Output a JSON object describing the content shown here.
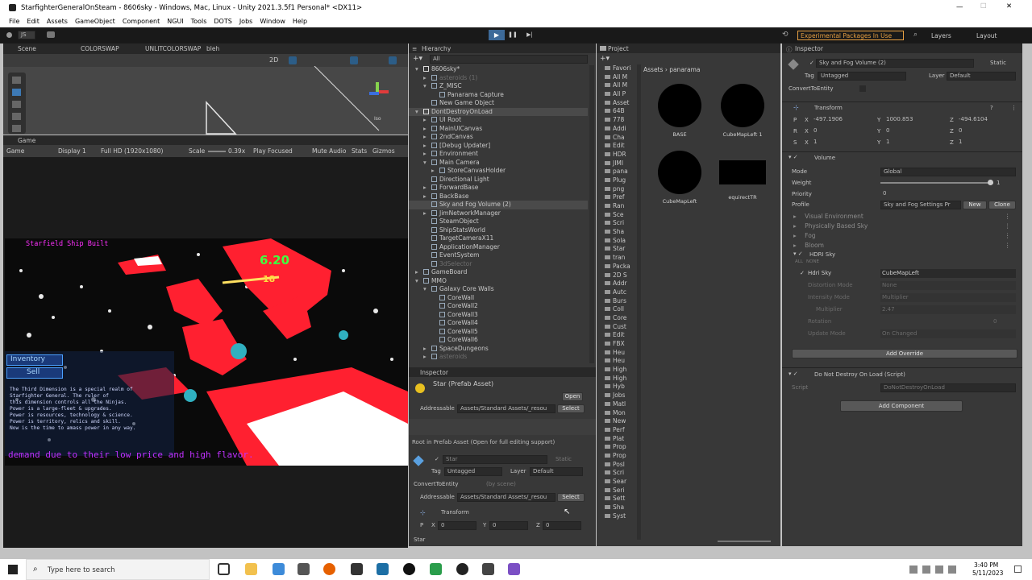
{
  "window": {
    "title": "StarfighterGeneralOnSteam - 8606sky - Windows, Mac, Linux - Unity 2021.3.5f1 Personal* <DX11>",
    "min": "—",
    "max": "☐",
    "close": "✕"
  },
  "menu": [
    "File",
    "Edit",
    "Assets",
    "GameObject",
    "Component",
    "NGUI",
    "Tools",
    "DOTS",
    "Jobs",
    "Window",
    "Help"
  ],
  "toolbar": {
    "account": "JS",
    "experimental": "Experimental Packages In Use",
    "layers": "Layers",
    "layout": "Layout"
  },
  "scene_tabs": [
    "Scene",
    "COLORSWAP",
    "UNLITCOLORSWAP",
    "bleh"
  ],
  "scene_toolbar": {
    "mode2d": "2D",
    "iso": "Iso"
  },
  "game_view": {
    "tab": "Game",
    "display_mode": "Game",
    "display": "Display 1",
    "resolution": "Full HD (1920x1080)",
    "scale_label": "Scale",
    "scale_value": "0.39x",
    "play_focused": "Play Focused",
    "mute": "Mute Audio",
    "stats": "Stats",
    "gizmos": "Gizmos",
    "hud_left": "Starfield Ship Built",
    "hud_score": "6.20",
    "hud_small": "18",
    "inventory": "Inventory",
    "sell": "Sell",
    "story": [
      "The Third Dimension is a special realm of",
      "Starfighter General. The ruler of",
      "this dimension controls all the Ninjas.",
      "Power is a large-fleet & upgrades.",
      "Power is resources, technology & science.",
      "Power is territory, relics and skill.",
      "Now is the time to amass power in any way."
    ],
    "banner": "demand due to their low price and high flavor."
  },
  "hierarchy": {
    "tab": "Hierarchy",
    "search": "All",
    "items": [
      {
        "label": "8606sky*",
        "indent": 0,
        "arrow": "▾",
        "icon": "unity"
      },
      {
        "label": "asteroids (1)",
        "indent": 1,
        "arrow": "▸",
        "dim": true
      },
      {
        "label": "Z_MISC",
        "indent": 1,
        "arrow": "▾"
      },
      {
        "label": "Panarama Capture",
        "indent": 2,
        "arrow": ""
      },
      {
        "label": "New Game Object",
        "indent": 1,
        "arrow": ""
      },
      {
        "label": "DontDestroyOnLoad",
        "indent": 0,
        "arrow": "▾",
        "icon": "unity",
        "section": true
      },
      {
        "label": "UI Root",
        "indent": 1,
        "arrow": "▸"
      },
      {
        "label": "MainUICanvas",
        "indent": 1,
        "arrow": "▸"
      },
      {
        "label": "2ndCanvas",
        "indent": 1,
        "arrow": "▸"
      },
      {
        "label": "[Debug Updater]",
        "indent": 1,
        "arrow": "▸"
      },
      {
        "label": "Environment",
        "indent": 1,
        "arrow": "▸"
      },
      {
        "label": "Main Camera",
        "indent": 1,
        "arrow": "▾"
      },
      {
        "label": "StoreCanvasHolder",
        "indent": 2,
        "arrow": "▸"
      },
      {
        "label": "Directional Light",
        "indent": 1,
        "arrow": ""
      },
      {
        "label": "ForwardBase",
        "indent": 1,
        "arrow": "▸"
      },
      {
        "label": "BackBase",
        "indent": 1,
        "arrow": "▸"
      },
      {
        "label": "Sky and Fog Volume (2)",
        "indent": 1,
        "arrow": "",
        "selected": true
      },
      {
        "label": "JimNetworkManager",
        "indent": 1,
        "arrow": "▸"
      },
      {
        "label": "SteamObject",
        "indent": 1,
        "arrow": ""
      },
      {
        "label": "ShipStatsWorld",
        "indent": 1,
        "arrow": ""
      },
      {
        "label": "TargetCameraX11",
        "indent": 1,
        "arrow": ""
      },
      {
        "label": "ApplicationManager",
        "indent": 1,
        "arrow": ""
      },
      {
        "label": "EventSystem",
        "indent": 1,
        "arrow": ""
      },
      {
        "label": "3dSelector",
        "indent": 1,
        "arrow": "",
        "dim": true
      },
      {
        "label": "GameBoard",
        "indent": 0,
        "arrow": "▸"
      },
      {
        "label": "MMO",
        "indent": 0,
        "arrow": "▾"
      },
      {
        "label": "Galaxy Core Walls",
        "indent": 1,
        "arrow": "▾"
      },
      {
        "label": "CoreWall",
        "indent": 2,
        "arrow": ""
      },
      {
        "label": "CoreWall2",
        "indent": 2,
        "arrow": ""
      },
      {
        "label": "CoreWall3",
        "indent": 2,
        "arrow": ""
      },
      {
        "label": "CoreWall4",
        "indent": 2,
        "arrow": ""
      },
      {
        "label": "CoreWall5",
        "indent": 2,
        "arrow": ""
      },
      {
        "label": "CoreWall6",
        "indent": 2,
        "arrow": ""
      },
      {
        "label": "SpaceDungeons",
        "indent": 1,
        "arrow": "▸"
      },
      {
        "label": "asteroids",
        "indent": 1,
        "arrow": "▸",
        "dim": true
      }
    ]
  },
  "inspector_small": {
    "tab": "Inspector",
    "asset_name": "Star (Prefab Asset)",
    "open": "Open",
    "addressable": "Addressable",
    "address_value": "Assets/Standard Assets/_resou",
    "select": "Select",
    "root_note": "Root in Prefab Asset (Open for full editing support)",
    "obj_name": "Star",
    "static": "Static",
    "tag_label": "Tag",
    "tag_value": "Untagged",
    "layer_label": "Layer",
    "layer_value": "Default",
    "convert": "ConvertToEntity",
    "by_scene": "(by scene)",
    "transform": "Transform",
    "px": "0",
    "py": "0",
    "pz": "0",
    "footer": "Star"
  },
  "project": {
    "tab": "Project",
    "breadcrumb": [
      "Assets",
      "panarama"
    ],
    "tree": [
      "Favori",
      "All M",
      "All M",
      "All P",
      "Asset",
      "64B",
      "778",
      "Addi",
      "Cha",
      "Edit",
      "HDR",
      "JIMI",
      "pana",
      "Plug",
      "png",
      "Pref",
      "Ran",
      "Sce",
      "Scri",
      "Sha",
      "Sola",
      "Star",
      "tran",
      "Packa",
      "2D S",
      "Addr",
      "Autc",
      "Burs",
      "Coll",
      "Core",
      "Cust",
      "Edit",
      "FBX",
      "Heu",
      "Heu",
      "High",
      "High",
      "Hyb",
      "Jobs",
      "Matl",
      "Mon",
      "New",
      "Perf",
      "Plat",
      "Prop",
      "Prop",
      "Posl",
      "Scri",
      "Sear",
      "Seri",
      "Sett",
      "Sha",
      "Syst"
    ],
    "assets": [
      {
        "name": "BASE",
        "shape": "circle"
      },
      {
        "name": "CubeMapLeft 1",
        "shape": "circle"
      },
      {
        "name": "CubeMapLeft",
        "shape": "circle"
      },
      {
        "name": "equirectTR",
        "shape": "rect"
      }
    ]
  },
  "inspector": {
    "tab": "Inspector",
    "obj_name": "Sky and Fog Volume (2)",
    "static": "Static",
    "tag_label": "Tag",
    "tag_value": "Untagged",
    "layer_label": "Layer",
    "layer_value": "Default",
    "convert": "ConvertToEntity",
    "transform": {
      "title": "Transform",
      "p": {
        "x": "-497.1906",
        "y": "1000.853",
        "z": "-494.6104"
      },
      "r": {
        "x": "0",
        "y": "0",
        "z": "0"
      },
      "s": {
        "x": "1",
        "y": "1",
        "z": "1"
      }
    },
    "volume": {
      "title": "Volume",
      "mode_label": "Mode",
      "mode_value": "Global",
      "weight_label": "Weight",
      "weight_value": "1",
      "weight_fraction": 0.97,
      "priority_label": "Priority",
      "priority_value": "0",
      "profile_label": "Profile",
      "profile_value": "Sky and Fog Settings Pr",
      "new": "New",
      "clone": "Clone"
    },
    "overrides": [
      "Visual Environment",
      "Physically Based Sky",
      "Fog",
      "Bloom"
    ],
    "hdri": {
      "title": "HDRI Sky",
      "all": "ALL",
      "none": "NONE",
      "rows": [
        {
          "label": "Hdri Sky",
          "value": "CubeMapLeft",
          "enabled": true
        },
        {
          "label": "Distortion Mode",
          "value": "None",
          "enabled": false
        },
        {
          "label": "Intensity Mode",
          "value": "Multiplier",
          "enabled": false
        },
        {
          "label": "Multiplier",
          "value": "2.47",
          "enabled": false
        },
        {
          "label": "Rotation",
          "value": "0",
          "enabled": false
        },
        {
          "label": "Update Mode",
          "value": "On Changed",
          "enabled": false
        }
      ]
    },
    "add_override": "Add Override",
    "dontdestroy": {
      "title": "Do Not Destroy On Load (Script)",
      "script_label": "Script",
      "script_value": "DoNotDestroyOnLoad"
    },
    "add_component": "Add Component"
  },
  "taskbar": {
    "search": "Type here to search",
    "time": "3:40 PM",
    "date": "5/11/2023"
  },
  "colors": {
    "accent": "#2c5d87",
    "panel": "#383838",
    "header": "#282828",
    "title_orange": "#e8a042",
    "hud_red": "#ff2030",
    "hud_green": "#40ff40",
    "hud_magenta": "#ff00ff"
  }
}
